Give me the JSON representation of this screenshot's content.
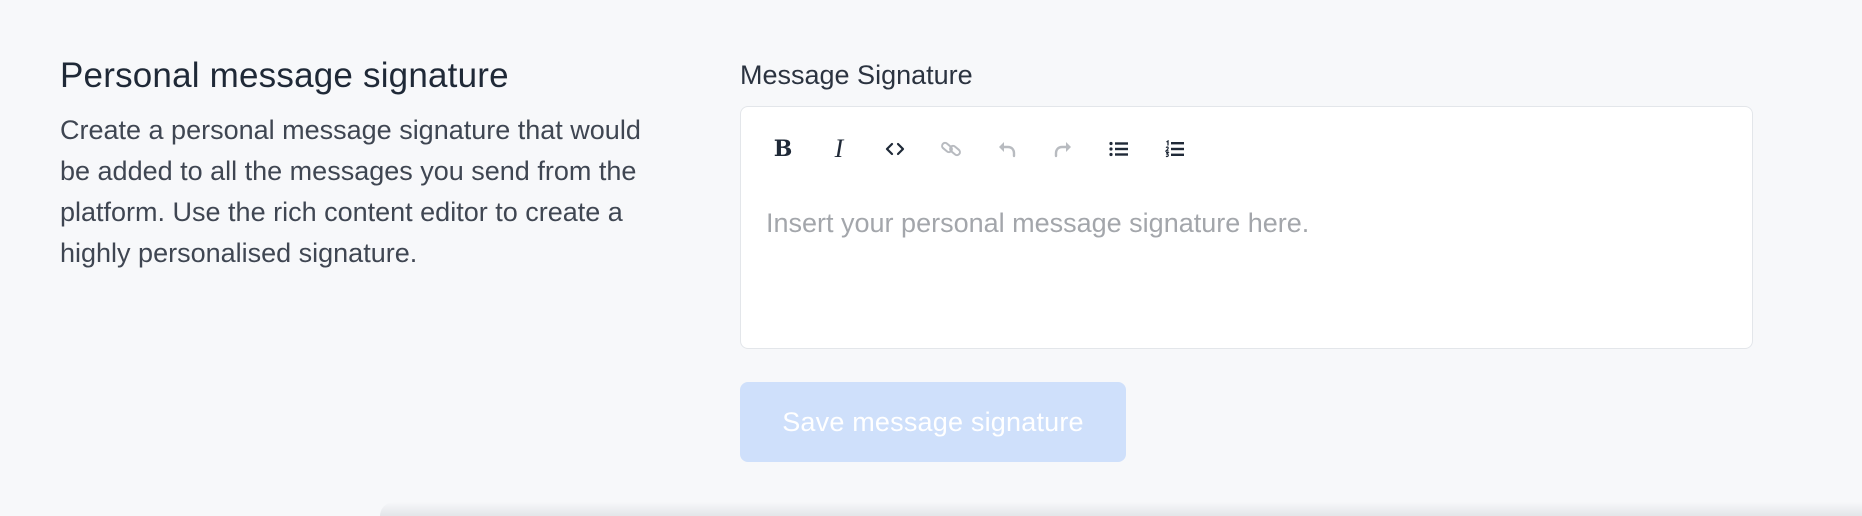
{
  "section": {
    "title": "Personal message signature",
    "description": "Create a personal message signature that would be added to all the messages you send from the platform. Use the rich content editor to create a highly personalised signature."
  },
  "editor": {
    "label": "Message Signature",
    "placeholder": "Insert your personal message signature here.",
    "toolbar": {
      "bold_label": "B",
      "italic_label": "I",
      "icons": [
        "bold-icon",
        "italic-icon",
        "code-icon",
        "link-icon",
        "undo-icon",
        "redo-icon",
        "bullet-list-icon",
        "ordered-list-icon"
      ]
    }
  },
  "actions": {
    "save_label": "Save message signature",
    "save_disabled": true
  },
  "colors": {
    "background": "#f7f8fa",
    "button_disabled": "#cfe0fb",
    "placeholder": "#a3a6ab",
    "icon_disabled": "#b8bbc0"
  }
}
